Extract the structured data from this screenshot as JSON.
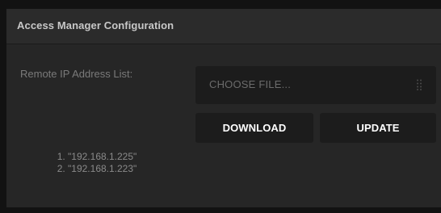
{
  "panel": {
    "title": "Access Manager Configuration"
  },
  "remote_ip": {
    "label": "Remote IP Address List:",
    "file_picker_placeholder": "CHOOSE FILE...",
    "file_picker_icon": "grip-dots-icon",
    "download_label": "DOWNLOAD",
    "update_label": "UPDATE",
    "entries": [
      "1. \"192.168.1.225\"",
      "2. \"192.168.1.223\""
    ]
  },
  "colors": {
    "background": "#121212",
    "panel": "#262626",
    "control": "#1c1c1c",
    "label_text": "#7a7a7a",
    "button_text": "#ffffff"
  }
}
